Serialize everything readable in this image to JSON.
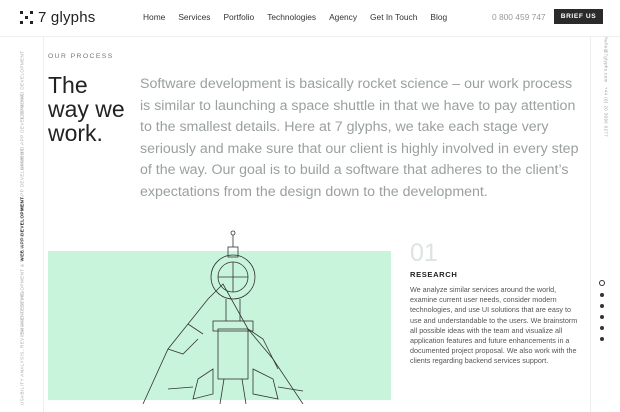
{
  "header": {
    "logo_text": "7 glyphs",
    "nav": [
      "Home",
      "Services",
      "Portfolio",
      "Technologies",
      "Agency",
      "Get In Touch",
      "Blog"
    ],
    "phone": "0 800 459 747",
    "brief_button": "BRIEF US"
  },
  "left_rail": {
    "items": [
      {
        "label": "Ideas and Development",
        "active": false
      },
      {
        "label": "Android App Development",
        "active": false
      },
      {
        "label": "iOS App Development",
        "active": false
      },
      {
        "label": "Web App Development",
        "active": true
      },
      {
        "label": "Backend Development & Solutions",
        "active": false
      },
      {
        "label": "Usability Analysis, Review and Testing",
        "active": false
      }
    ]
  },
  "right_rail": {
    "text_top": "+44 (0) 20 3096 0277",
    "text_bottom": "hello@7glyphs.com",
    "dots_count": 6,
    "active_dot": 0
  },
  "main": {
    "eyebrow": "OUR PROCESS",
    "title_line1": "The",
    "title_line2": "way we",
    "title_line3": "work.",
    "intro": "Software development is basically rocket science – our work process is similar to launching a space shuttle in that we have to pay attention to the smallest details. Here at 7 glyphs, we take each stage very seriously and make sure that our client is highly involved in every step of the way. Our goal is to build a software that adheres to the client’s expectations from the design down to the development."
  },
  "step": {
    "number": "01",
    "title": "RESEARCH",
    "text": "We analyze similar services around the world, examine current user needs, consider modern technologies, and use UI solutions that are easy to use and understandable to the users. We brainstorm all possible ideas with the team and visualize all application features and future enhancements in a documented project proposal. We also work with the clients regarding backend services support."
  },
  "colors": {
    "accent_bg": "#c9f4dc",
    "button_bg": "#2a2a2a",
    "intro_text": "#9aa0a0"
  }
}
